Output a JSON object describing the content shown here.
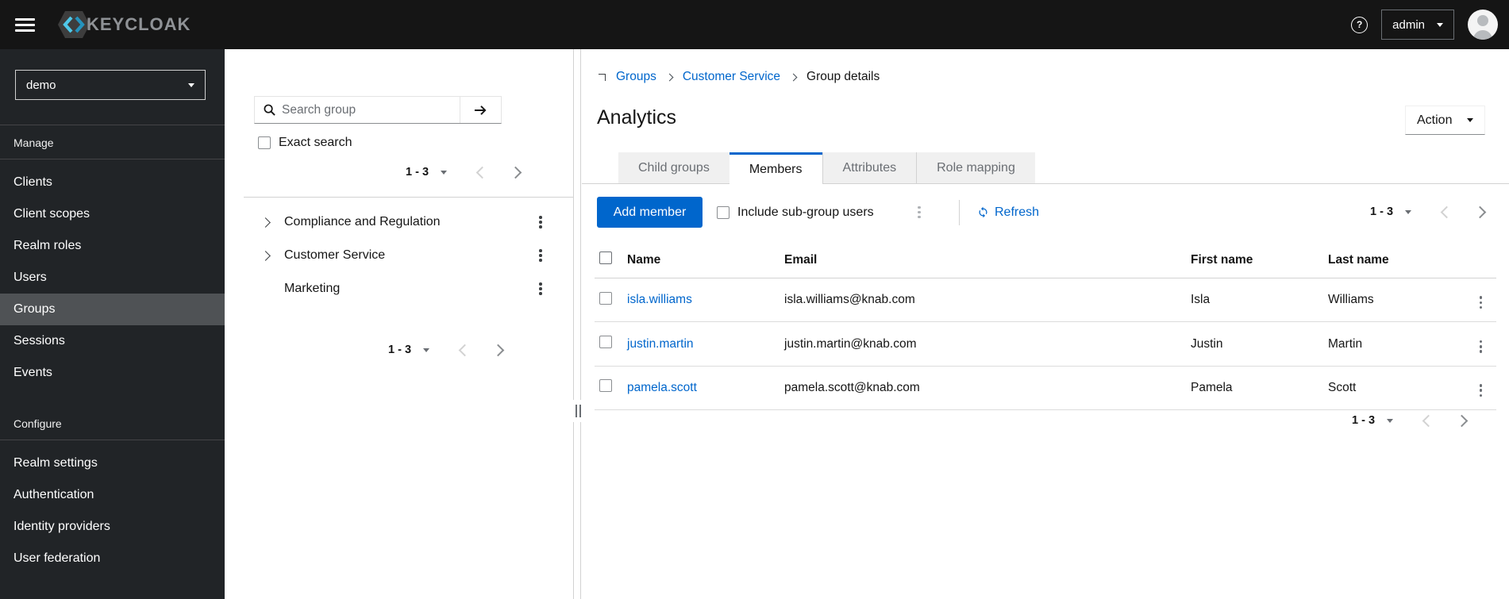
{
  "topbar": {
    "logo_text": "KEYCLOAK",
    "user_menu_label": "admin"
  },
  "sidebar": {
    "realm": "demo",
    "selected_item": "Groups",
    "sections": [
      {
        "label": "Manage",
        "items": [
          "Clients",
          "Client scopes",
          "Realm roles",
          "Users",
          "Groups",
          "Sessions",
          "Events"
        ]
      },
      {
        "label": "Configure",
        "items": [
          "Realm settings",
          "Authentication",
          "Identity providers",
          "User federation"
        ]
      }
    ]
  },
  "groups_panel": {
    "search_placeholder": "Search group",
    "exact_search_label": "Exact search",
    "pagination_top": "1 - 3",
    "pagination_bottom": "1 - 3",
    "groups": [
      {
        "name": "Compliance and Regulation",
        "expandable": true
      },
      {
        "name": "Customer Service",
        "expandable": true
      },
      {
        "name": "Marketing",
        "expandable": false
      }
    ]
  },
  "main": {
    "breadcrumb": {
      "items": [
        "Groups",
        "Customer Service"
      ],
      "current": "Group details"
    },
    "title": "Analytics",
    "action_button_label": "Action",
    "tabs": [
      "Child groups",
      "Members",
      "Attributes",
      "Role mapping"
    ],
    "active_tab": "Members",
    "toolbar": {
      "add_member_label": "Add member",
      "include_subgroup_label": "Include sub-group users",
      "refresh_label": "Refresh",
      "pagination": "1 - 3"
    },
    "members_table": {
      "headers": [
        "Name",
        "Email",
        "First name",
        "Last name"
      ],
      "rows": [
        {
          "name": "isla.williams",
          "email": "isla.williams@knab.com",
          "first_name": "Isla",
          "last_name": "Williams"
        },
        {
          "name": "justin.martin",
          "email": "justin.martin@knab.com",
          "first_name": "Justin",
          "last_name": "Martin"
        },
        {
          "name": "pamela.scott",
          "email": "pamela.scott@knab.com",
          "first_name": "Pamela",
          "last_name": "Scott"
        }
      ]
    },
    "pagination_bottom": "1 - 3"
  },
  "icons": {
    "hamburger": "three-bars",
    "help": "question-mark-circle",
    "avatar": "user-silhouette-circle",
    "search": "magnifier",
    "search_submit": "arrow-right",
    "refresh": "sync-arrows",
    "kebab": "vertical-dots",
    "caret": "triangle-down",
    "pagination_prev": "angle-left",
    "pagination_next": "angle-right"
  },
  "colors": {
    "accent": "#0066cc",
    "topbar_bg": "#151515",
    "sidebar_bg": "#212427",
    "sidebar_selected_bg": "#4f5255",
    "tab_inactive_bg": "#f0f0f0",
    "border": "#d2d2d2",
    "text": "#151515",
    "muted_text": "#6a6e73",
    "link": "#0066cc"
  }
}
